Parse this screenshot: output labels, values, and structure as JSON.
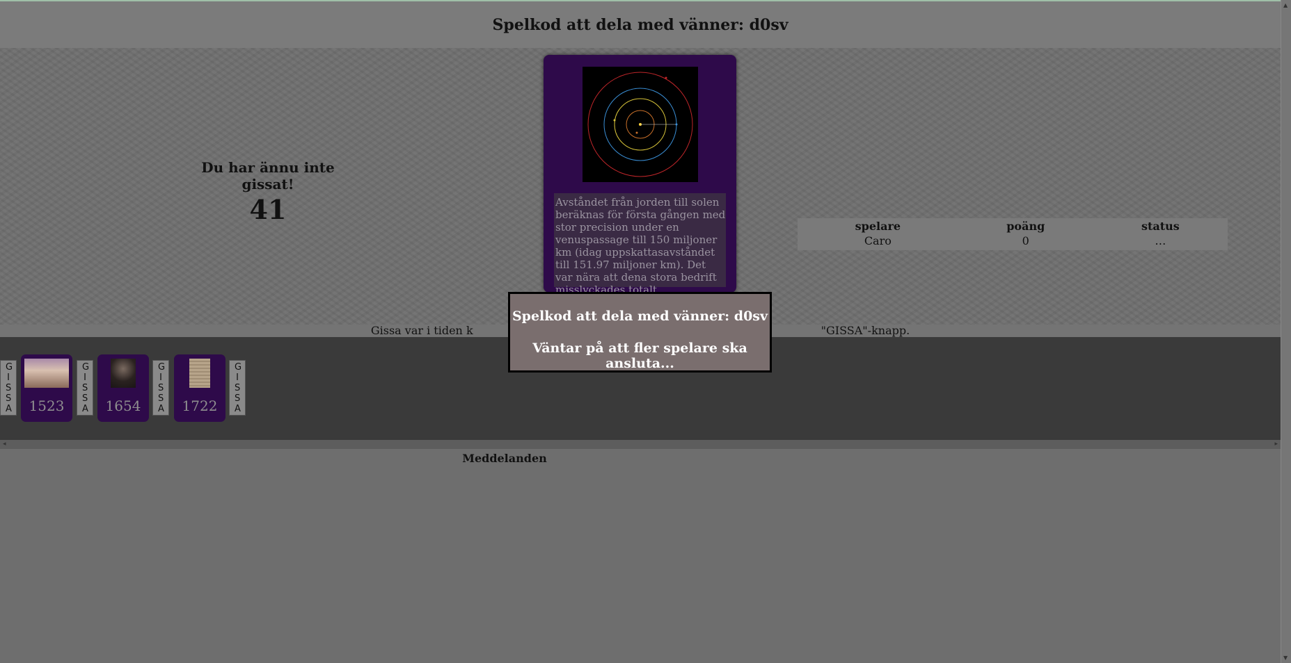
{
  "header": {
    "title": "Spelkod att dela med vänner: d0sv"
  },
  "guess_status": {
    "message": "Du har ännu inte gissat!",
    "countdown": "41"
  },
  "current_card": {
    "image_icon": "solar-orbits-diagram-icon",
    "text": "Avståndet från jorden till solen beräknas för första gången med stor precision under en venuspassage till 150 miljoner km (idag uppskattasavståndet till 151.97 miljoner km). Det var nära att dena stora bedrift misslyckades totalt."
  },
  "scoreboard": {
    "headers": [
      "spelare",
      "poäng",
      "status"
    ],
    "rows": [
      [
        "Caro",
        "0",
        "…"
      ]
    ]
  },
  "instructions": {
    "left": "Gissa var i tiden k",
    "right": "\"GISSA\"-knapp."
  },
  "timeline": {
    "gissa_label": "GISSA",
    "cards": [
      {
        "year": "1523",
        "thumb_icon": "painting-thumbnail"
      },
      {
        "year": "1654",
        "thumb_icon": "portrait-thumbnail"
      },
      {
        "year": "1722",
        "thumb_icon": "document-thumbnail"
      }
    ]
  },
  "messages": {
    "title": "Meddelanden"
  },
  "modal": {
    "line1": "Spelkod att dela med vänner: d0sv",
    "line2": "Väntar på att fler spelare ska ansluta..."
  },
  "colors": {
    "card_purple": "#2e0a4a",
    "modal_bg": "#7a6e6e",
    "timeline_bg": "#3a3a3a"
  }
}
